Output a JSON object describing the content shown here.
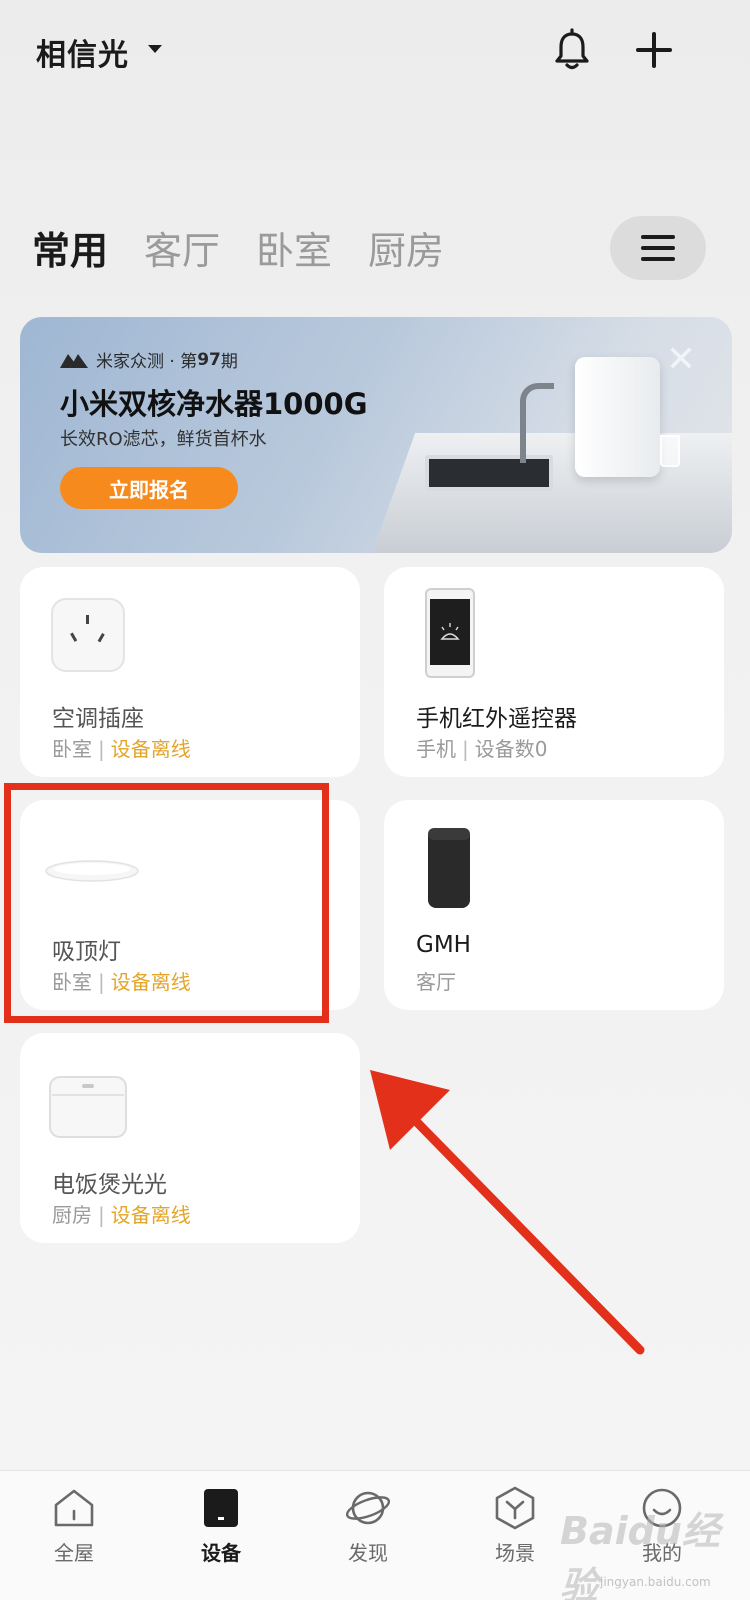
{
  "header": {
    "home_name": "相信光"
  },
  "tabs": [
    {
      "label": "常用",
      "active": true
    },
    {
      "label": "客厅",
      "active": false
    },
    {
      "label": "卧室",
      "active": false
    },
    {
      "label": "厨房",
      "active": false
    }
  ],
  "banner": {
    "brand": "米家众测 · 第",
    "issue": "97",
    "issue_suffix": "期",
    "title": "小米双核净水器1000G",
    "subtitle": "长效RO滤芯，鲜货首杯水",
    "cta": "立即报名",
    "close": "✕"
  },
  "devices": [
    {
      "name": "空调插座",
      "room": "卧室",
      "status": "设备离线"
    },
    {
      "name": "手机红外遥控器",
      "room": "手机",
      "status": "设备数0"
    },
    {
      "name": "吸顶灯",
      "room": "卧室",
      "status": "设备离线"
    },
    {
      "name": "GMH",
      "room": "客厅",
      "status": ""
    },
    {
      "name": "电饭煲光光",
      "room": "厨房",
      "status": "设备离线"
    }
  ],
  "bottom_nav": [
    {
      "label": "全屋",
      "icon": "home-icon",
      "active": false
    },
    {
      "label": "设备",
      "icon": "device-icon",
      "active": true
    },
    {
      "label": "发现",
      "icon": "planet-icon",
      "active": false
    },
    {
      "label": "场景",
      "icon": "scene-icon",
      "active": false
    },
    {
      "label": "我的",
      "icon": "profile-icon",
      "active": false
    }
  ],
  "watermark": {
    "text": "Baidu经验",
    "sub": "jingyan.baidu.com"
  },
  "colors": {
    "accent_orange": "#f68a1d",
    "offline_yellow": "#e4a52b",
    "highlight_red": "#e2301b"
  }
}
